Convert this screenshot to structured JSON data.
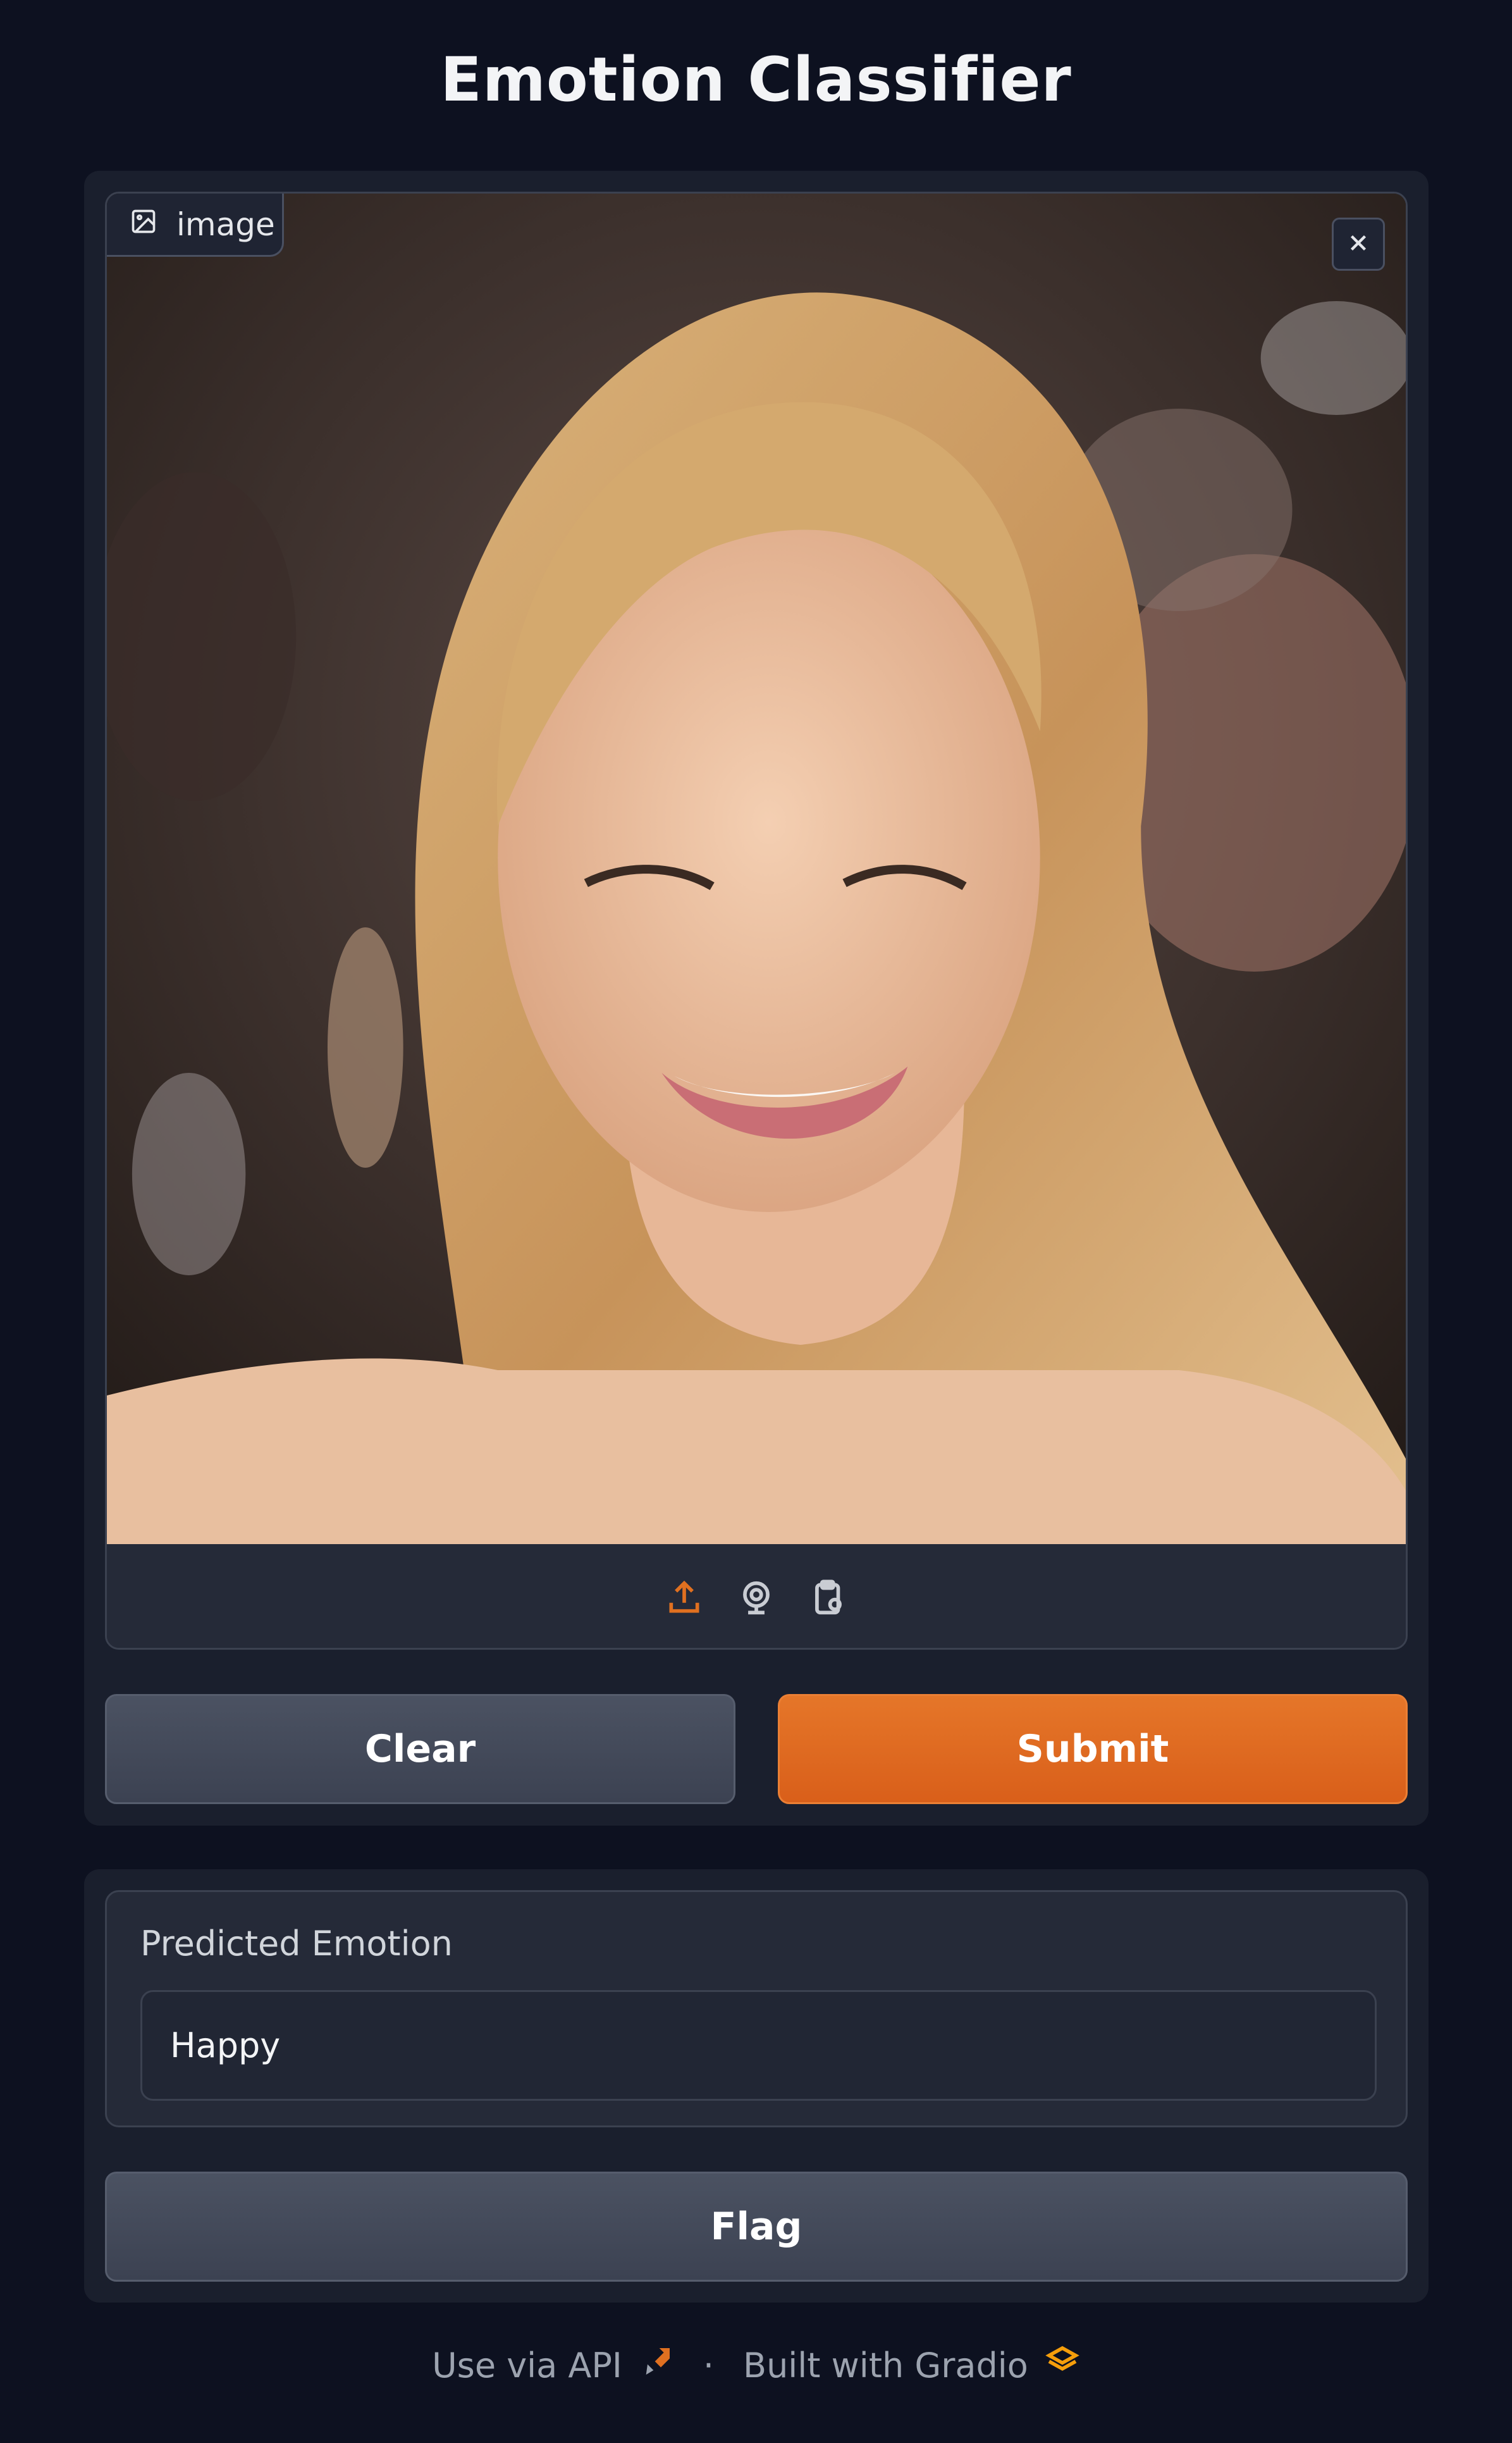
{
  "app": {
    "title": "Emotion Classifier"
  },
  "input": {
    "label": "image",
    "label_icon": "image-icon",
    "close_icon": "close-icon",
    "sources": [
      {
        "name": "upload-icon",
        "color": "#e07020"
      },
      {
        "name": "webcam-icon",
        "color": "#c9ccd3"
      },
      {
        "name": "clipboard-icon",
        "color": "#c9ccd3"
      }
    ]
  },
  "buttons": {
    "clear_label": "Clear",
    "submit_label": "Submit",
    "flag_label": "Flag"
  },
  "output": {
    "label": "Predicted Emotion",
    "value": "Happy"
  },
  "footer": {
    "api_label": "Use via API",
    "separator": "·",
    "built_label": "Built with Gradio",
    "api_icon": "rocket-icon",
    "gradio_icon": "gradio-logo-icon"
  },
  "colors": {
    "background": "#0d1120",
    "panel": "#1a1f2d",
    "accent": "#e07020",
    "secondary_button": "#434a5a"
  }
}
